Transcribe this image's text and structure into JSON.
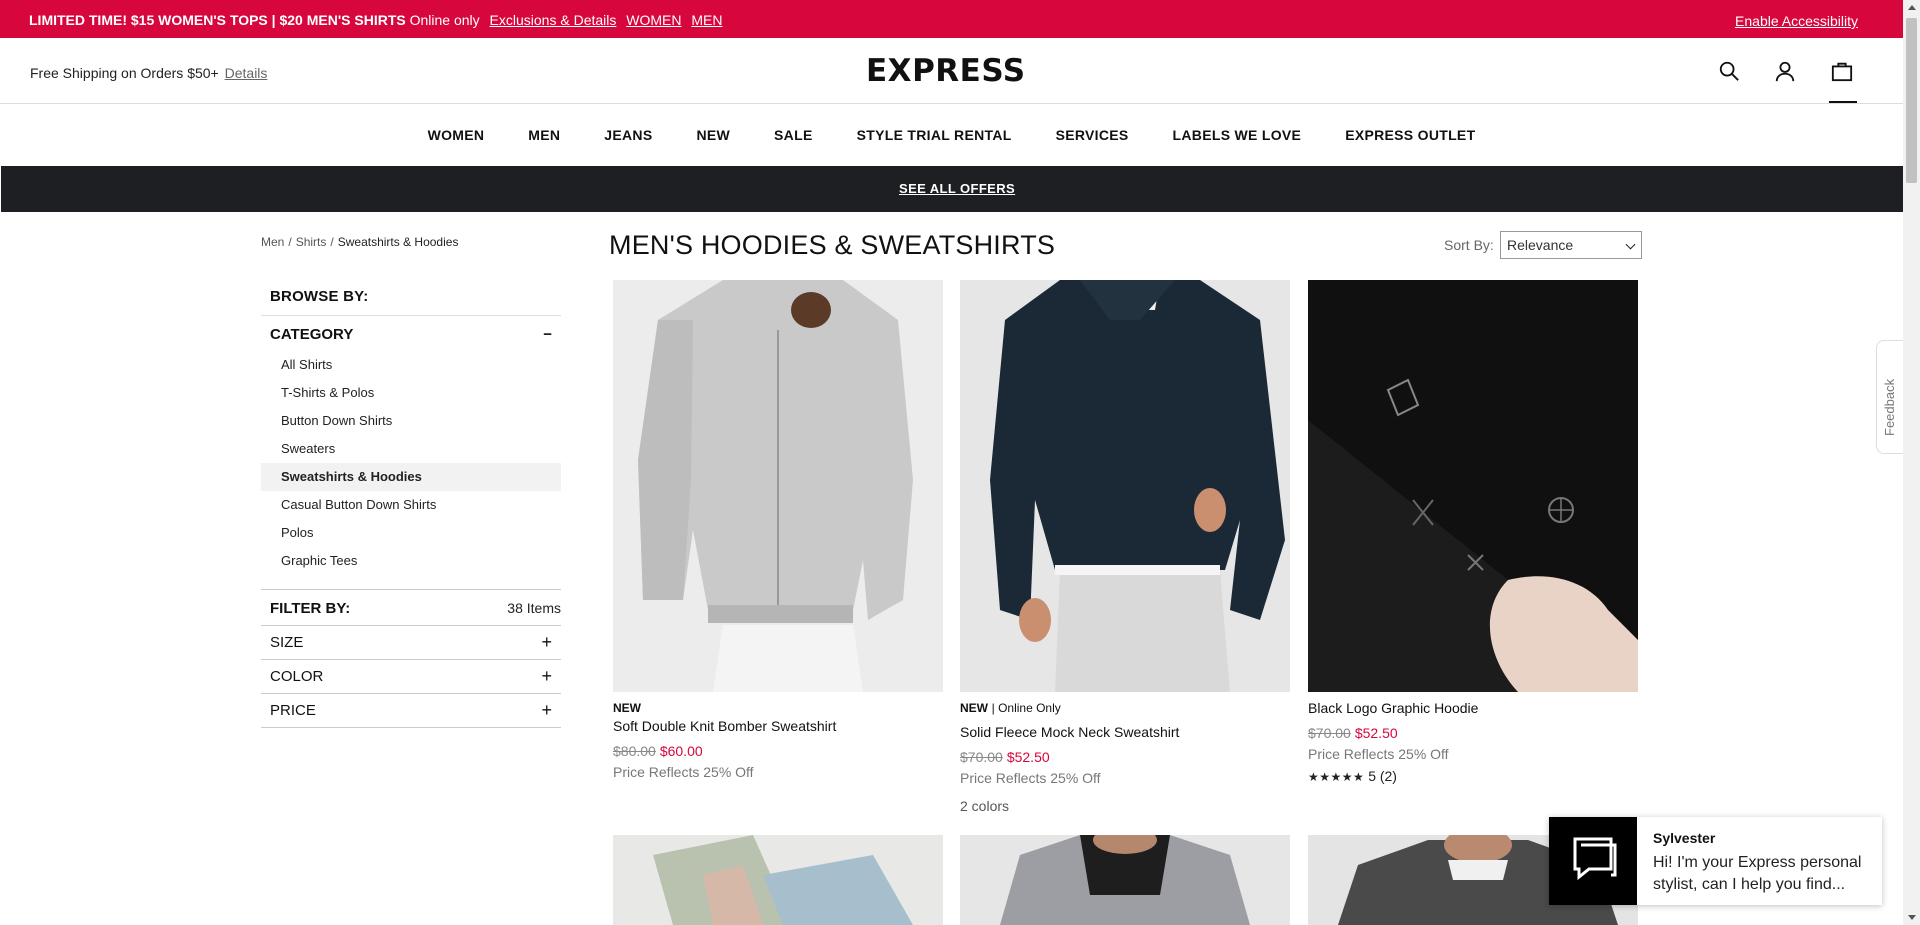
{
  "promo": {
    "headline": "LIMITED TIME! $15 WOMEN'S TOPS | $20 MEN'S SHIRTS",
    "online_only": "Online only",
    "links": [
      "Exclusions & Details",
      "WOMEN",
      "MEN"
    ],
    "accessibility": "Enable Accessibility",
    "bg_color": "#d7063c"
  },
  "header": {
    "shipping": "Free Shipping on Orders $50+",
    "shipping_link": "Details",
    "logo": "EXPRESS",
    "icons": [
      "search-icon",
      "account-icon",
      "bag-icon"
    ]
  },
  "nav": [
    "WOMEN",
    "MEN",
    "JEANS",
    "NEW",
    "SALE",
    "STYLE TRIAL RENTAL",
    "SERVICES",
    "LABELS WE LOVE",
    "EXPRESS OUTLET"
  ],
  "offers_bar": {
    "label": "SEE ALL OFFERS"
  },
  "breadcrumb": [
    "Men",
    "Shirts",
    "Sweatshirts & Hoodies"
  ],
  "sidebar": {
    "browse_by": "BROWSE BY:",
    "category_title": "CATEGORY",
    "category_toggle": "−",
    "categories": [
      "All Shirts",
      "T-Shirts & Polos",
      "Button Down Shirts",
      "Sweaters",
      "Sweatshirts & Hoodies",
      "Casual Button Down Shirts",
      "Polos",
      "Graphic Tees"
    ],
    "active_category": "Sweatshirts & Hoodies",
    "filter_by": "FILTER BY:",
    "item_count": "38 Items",
    "facets": [
      "SIZE",
      "COLOR",
      "PRICE"
    ],
    "facet_toggle": "+"
  },
  "main": {
    "title": "MEN'S HOODIES & SWEATSHIRTS",
    "sort_label": "Sort By:",
    "sort_value": "Relevance"
  },
  "products": [
    {
      "badge": "NEW",
      "badge_extra": "",
      "name": "Soft Double Knit Bomber Sweatshirt",
      "orig_price": "$80.00",
      "sale_price": "$60.00",
      "reflect": "Price Reflects 25% Off",
      "colors": "",
      "rating": ""
    },
    {
      "badge": "NEW",
      "badge_extra": "| Online Only",
      "name": "Solid Fleece Mock Neck Sweatshirt",
      "orig_price": "$70.00",
      "sale_price": "$52.50",
      "reflect": "Price Reflects 25% Off",
      "colors": "2 colors",
      "rating": ""
    },
    {
      "badge": "",
      "badge_extra": "",
      "name": "Black Logo Graphic Hoodie",
      "orig_price": "$70.00",
      "sale_price": "$52.50",
      "reflect": "Price Reflects 25% Off",
      "colors": "",
      "stars": "★★★★★",
      "rating": "5 (2)",
      "rating_value": 5
    }
  ],
  "feedback": "Feedback",
  "chat": {
    "name": "Sylvester",
    "message": "Hi! I'm your Express personal stylist, can I help you find..."
  }
}
